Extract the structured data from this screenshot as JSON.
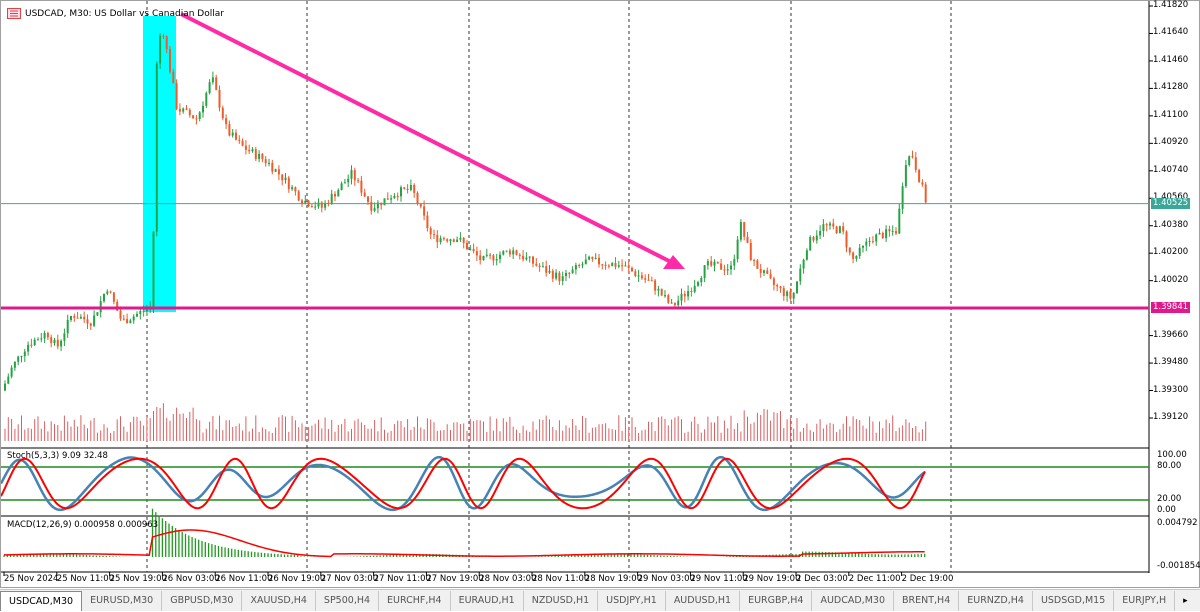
{
  "chart": {
    "symbol_title": "USDCAD, M30:  US Dollar vs Canadian Dollar",
    "price_axis": [
      "1.41820",
      "1.41640",
      "1.41460",
      "1.41280",
      "1.41100",
      "1.40920",
      "1.40740",
      "1.40560",
      "1.40380",
      "1.40200",
      "1.40020",
      "1.39660",
      "1.39480",
      "1.39300",
      "1.39120"
    ],
    "current_price": "1.40525",
    "support_level": "1.39841",
    "stoch_label": "Stoch(5,3,3) 9.09 32.48",
    "stoch_axis": [
      "100.00",
      "80.00",
      "20.00",
      "0.00"
    ],
    "macd_label": "MACD(12,26,9) 0.000958 0.000963",
    "macd_axis": [
      "0.004792",
      "-0.001854"
    ],
    "time_axis": [
      "25 Nov 2024",
      "25 Nov 11:00",
      "25 Nov 19:00",
      "26 Nov 03:00",
      "26 Nov 11:00",
      "26 Nov 19:00",
      "27 Nov 03:00",
      "27 Nov 11:00",
      "27 Nov 19:00",
      "28 Nov 03:00",
      "28 Nov 11:00",
      "28 Nov 19:00",
      "29 Nov 03:00",
      "29 Nov 11:00",
      "29 Nov 19:00",
      "2 Dec 03:00",
      "2 Dec 11:00",
      "2 Dec 19:00"
    ],
    "price_path": [
      [
        0,
        1.393
      ],
      [
        10,
        1.3945
      ],
      [
        25,
        1.396
      ],
      [
        45,
        1.3968
      ],
      [
        55,
        1.3958
      ],
      [
        70,
        1.398
      ],
      [
        90,
        1.3975
      ],
      [
        105,
        1.3998
      ],
      [
        120,
        1.3975
      ],
      [
        150,
        1.3985
      ],
      [
        155,
        1.415
      ],
      [
        160,
        1.417
      ],
      [
        175,
        1.4115
      ],
      [
        195,
        1.4108
      ],
      [
        210,
        1.4135
      ],
      [
        225,
        1.41
      ],
      [
        240,
        1.409
      ],
      [
        265,
        1.408
      ],
      [
        280,
        1.407
      ],
      [
        300,
        1.4055
      ],
      [
        320,
        1.405
      ],
      [
        350,
        1.4072
      ],
      [
        370,
        1.405
      ],
      [
        395,
        1.406
      ],
      [
        410,
        1.4062
      ],
      [
        430,
        1.403
      ],
      [
        455,
        1.403
      ],
      [
        480,
        1.4015
      ],
      [
        510,
        1.4022
      ],
      [
        540,
        1.401
      ],
      [
        560,
        1.4003
      ],
      [
        585,
        1.4015
      ],
      [
        620,
        1.4012
      ],
      [
        650,
        1.4
      ],
      [
        670,
        1.3985
      ],
      [
        690,
        1.3998
      ],
      [
        705,
        1.4012
      ],
      [
        730,
        1.401
      ],
      [
        738,
        1.404
      ],
      [
        750,
        1.4015
      ],
      [
        770,
        1.4
      ],
      [
        790,
        1.399
      ],
      [
        805,
        1.4025
      ],
      [
        820,
        1.4038
      ],
      [
        840,
        1.4035
      ],
      [
        850,
        1.4015
      ],
      [
        870,
        1.403
      ],
      [
        895,
        1.4035
      ],
      [
        903,
        1.408
      ],
      [
        910,
        1.4085
      ],
      [
        925,
        1.4052
      ]
    ],
    "colors": {
      "bull": "#26a244",
      "bear": "#ef5b2a",
      "support": "#e0198c",
      "current": "#3aa899",
      "highlight": "#00ffff",
      "arrow": "#ff2aa5",
      "stoch_main": "#4682b4",
      "stoch_signal": "#ff0000",
      "macd_hist": "#1f9a1f",
      "level": "#1f8c1f"
    }
  },
  "tabs": [
    {
      "label": "USDCAD,M30",
      "active": true
    },
    {
      "label": "EURUSD,M30"
    },
    {
      "label": "GBPUSD,M30"
    },
    {
      "label": "XAUUSD,H4"
    },
    {
      "label": "SP500,H4"
    },
    {
      "label": "EURCHF,H4"
    },
    {
      "label": "EURAUD,H1"
    },
    {
      "label": "NZDUSD,H1"
    },
    {
      "label": "USDJPY,H1"
    },
    {
      "label": "AUDUSD,H1"
    },
    {
      "label": "EURGBP,H4"
    },
    {
      "label": "AUDCAD,M30"
    },
    {
      "label": "BRENT,H4"
    },
    {
      "label": "EURNZD,H4"
    },
    {
      "label": "USDSGD,M15"
    },
    {
      "label": "EURJPY,H"
    }
  ],
  "tabs_scroll_icon": "chevron-right-icon"
}
